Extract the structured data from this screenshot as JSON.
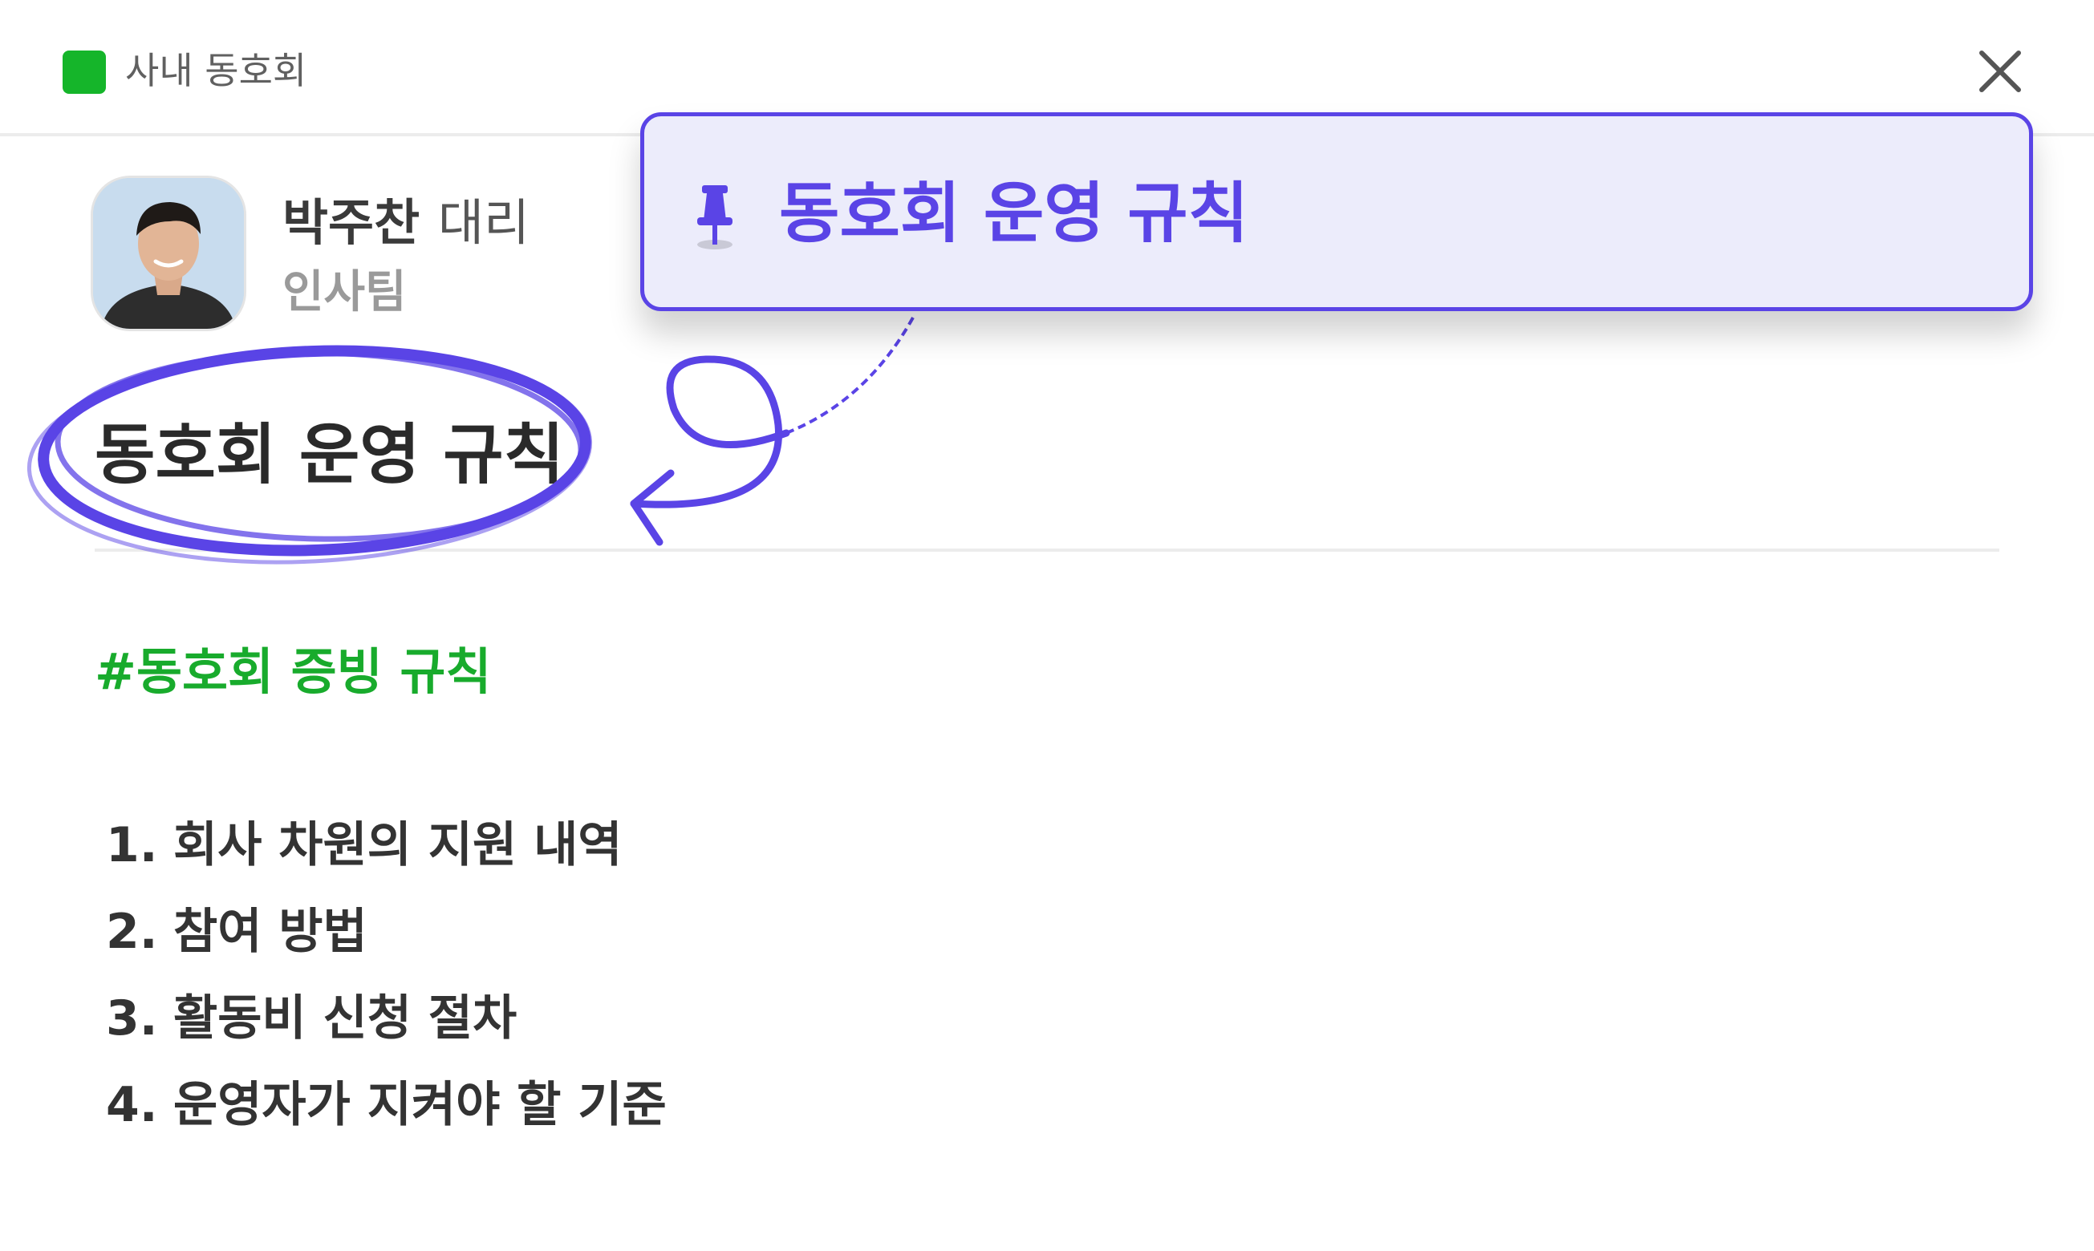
{
  "header": {
    "channel_name": "사내 동호회",
    "channel_color": "#15b52a",
    "close_icon": "close-icon"
  },
  "author": {
    "name": "박주찬",
    "role": "대리",
    "team": "인사팀"
  },
  "post": {
    "title": "동호회 운영 규칙",
    "hashtag": "#동호회 증빙 규칙",
    "hashtag_color": "#18ab2c",
    "items": [
      {
        "num": "1.",
        "text": "회사 차원의 지원 내역"
      },
      {
        "num": "2.",
        "text": "참여 방법"
      },
      {
        "num": "3.",
        "text": "활동비 신청 절차"
      },
      {
        "num": "4.",
        "text": "운영자가 지켜야 할 기준"
      }
    ]
  },
  "pinned": {
    "icon": "pin-icon",
    "title": "동호회 운영 규칙",
    "accent_color": "#5a44e6"
  }
}
